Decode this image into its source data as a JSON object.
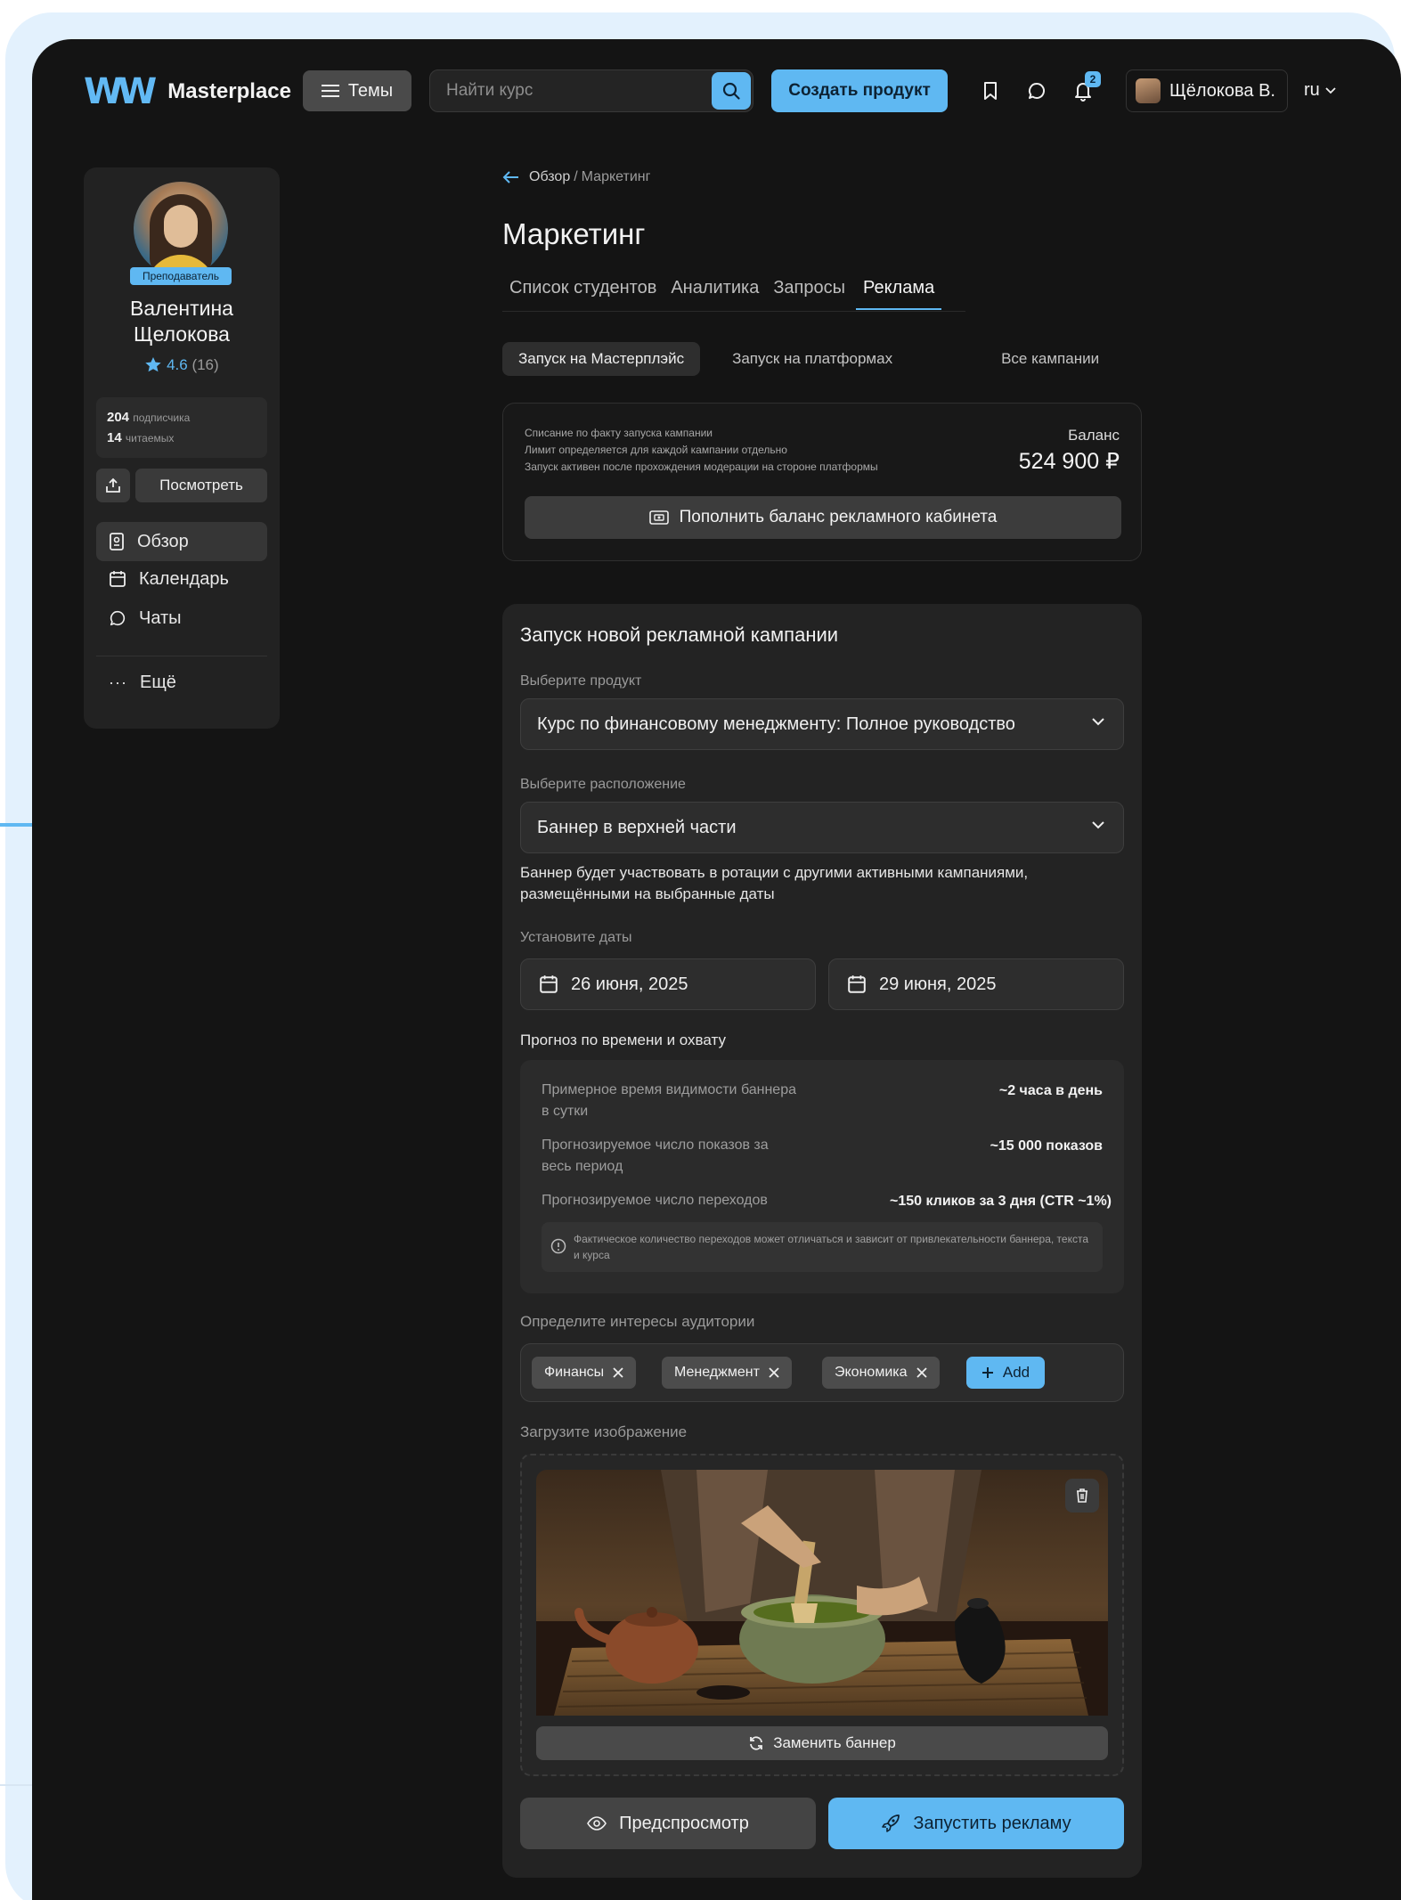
{
  "header": {
    "logo_mark": "W",
    "logo_text": "Masterplace",
    "themes_label": "Темы",
    "search_placeholder": "Найти курс",
    "create_label": "Создать продукт",
    "notifications_count": "2",
    "user_name": "Щёлокова В.",
    "lang": "ru"
  },
  "profile": {
    "role": "Преподаватель",
    "name_line1": "Валентина",
    "name_line2": "Щелокова",
    "rating": "4.6",
    "rating_count": "(16)",
    "subscribers_count": "204",
    "subscribers_label": "подписчика",
    "readers_count": "14",
    "readers_label": "читаемых",
    "view_label": "Посмотреть"
  },
  "nav": {
    "overview": "Обзор",
    "calendar": "Календарь",
    "chats": "Чаты",
    "more": "Ещё"
  },
  "breadcrumb": {
    "root": "Обзор",
    "separator": "/",
    "current": "Маркетинг"
  },
  "page_title": "Маркетинг",
  "tabs": [
    "Список студентов",
    "Аналитика",
    "Запросы",
    "Реклама"
  ],
  "subtabs": [
    "Запуск на Мастерплэйс",
    "Запуск на платформах",
    "Все кампании"
  ],
  "balance": {
    "note1": "Списание по факту запуска кампании",
    "note2": "Лимит определяется для каждой кампании отдельно",
    "note3": "Запуск активен после прохождения модерации на стороне платформы",
    "label": "Баланс",
    "value": "524 900 ₽",
    "topup_label": "Пополнить баланс рекламного кабинета"
  },
  "form": {
    "title": "Запуск новой рекламной кампании",
    "product_label": "Выберите продукт",
    "product_value": "Курс по финансовому менеджменту: Полное руководство",
    "placement_label": "Выберите расположение",
    "placement_value": "Баннер в верхней части",
    "placement_hint": "Баннер будет участвовать в ротации с другими активными кампаниями, размещёнными на выбранные даты",
    "dates_label": "Установите даты",
    "date_start": "26 июня, 2025",
    "date_end": "29 июня, 2025",
    "forecast_label": "Прогноз по времени и охвату",
    "forecast": [
      {
        "label": "Примерное время видимости баннера в сутки",
        "value": "~2 часа в день"
      },
      {
        "label": "Прогнозируемое число показов за весь период",
        "value": "~15 000 показов"
      },
      {
        "label": "Прогнозируемое число переходов",
        "value": "~150 кликов за 3 дня (CTR ~1%)"
      }
    ],
    "forecast_notice": "Фактическое количество переходов может отличаться и зависит от привлекательности баннера, текста и курса",
    "interests_label": "Определите интересы аудитории",
    "interests": [
      "Финансы",
      "Менеджмент",
      "Экономика"
    ],
    "add_label": "Add",
    "upload_label": "Загрузите изображение",
    "replace_label": "Заменить баннер",
    "preview_label": "Предспросмотр",
    "launch_label": "Запустить рекламу"
  },
  "colors": {
    "accent": "#5fb8f2",
    "background": "#141414",
    "card": "#232323",
    "frame": "#e3f1fd"
  }
}
